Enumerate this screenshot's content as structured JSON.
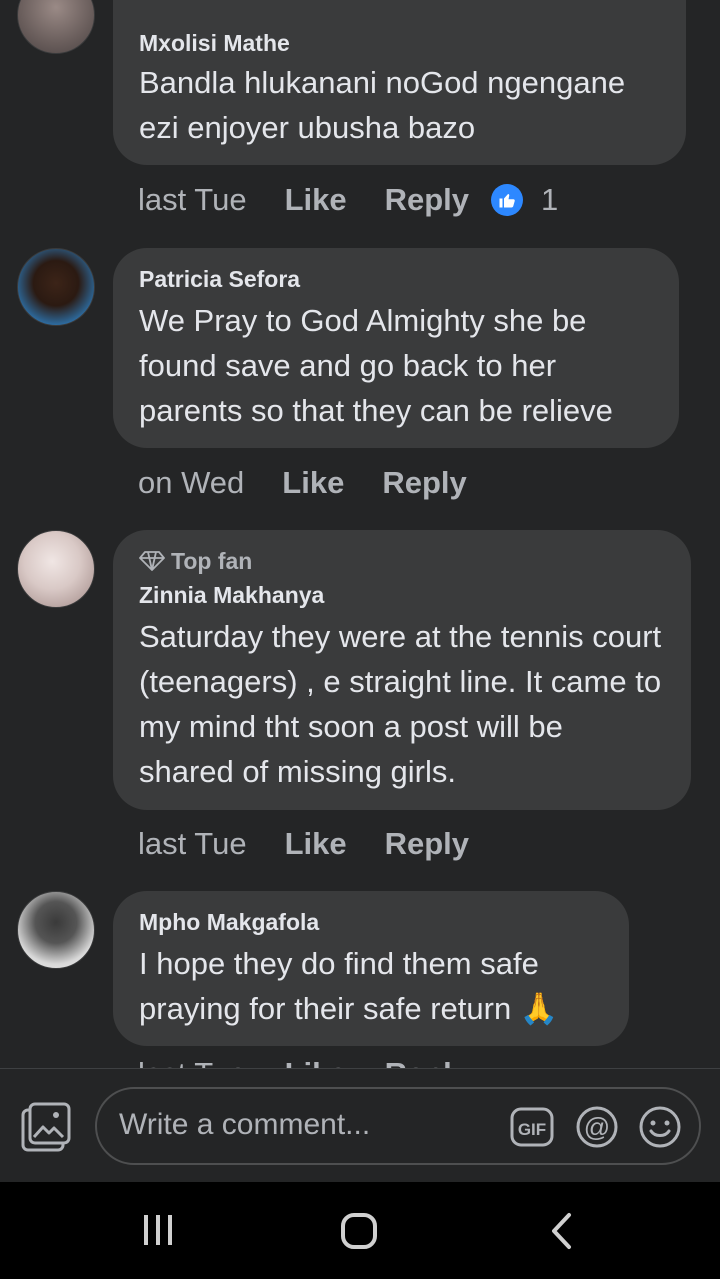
{
  "comments": [
    {
      "author": "Mxolisi Mathe",
      "text": "Bandla hlukanani noGod ngengane ezi enjoyer ubusha bazo",
      "time": "last Tue",
      "like_label": "Like",
      "reply_label": "Reply",
      "reaction_count": "1"
    },
    {
      "author": "Patricia Sefora",
      "text": "We Pray to God Almighty she be found save and go back to her parents so that they can be relieve",
      "time": "on Wed",
      "like_label": "Like",
      "reply_label": "Reply"
    },
    {
      "badge": "Top fan",
      "author": "Zinnia Makhanya",
      "text": "Saturday they were at the tennis court (teenagers) , e straight line. It came to my mind tht soon a post will be shared of missing girls.",
      "time": "last Tue",
      "like_label": "Like",
      "reply_label": "Reply"
    },
    {
      "author": "Mpho Makgafola",
      "text": "I hope they do find them safe praying for their safe return 🙏",
      "time": "last Tue",
      "like_label": "Like",
      "reply_label": "Reply"
    }
  ],
  "composer": {
    "placeholder": "Write a comment...",
    "gif_label": "GIF"
  },
  "icons": [
    "photo-icon",
    "gif-icon",
    "mention-icon",
    "emoji-icon",
    "like-thumb-icon",
    "diamond-icon",
    "recent-apps-icon",
    "home-icon",
    "back-icon"
  ],
  "colors": {
    "background": "#242526",
    "bubble": "#3a3b3c",
    "text": "#e4e6eb",
    "muted": "#b0b3b8",
    "accent": "#2d88ff"
  }
}
